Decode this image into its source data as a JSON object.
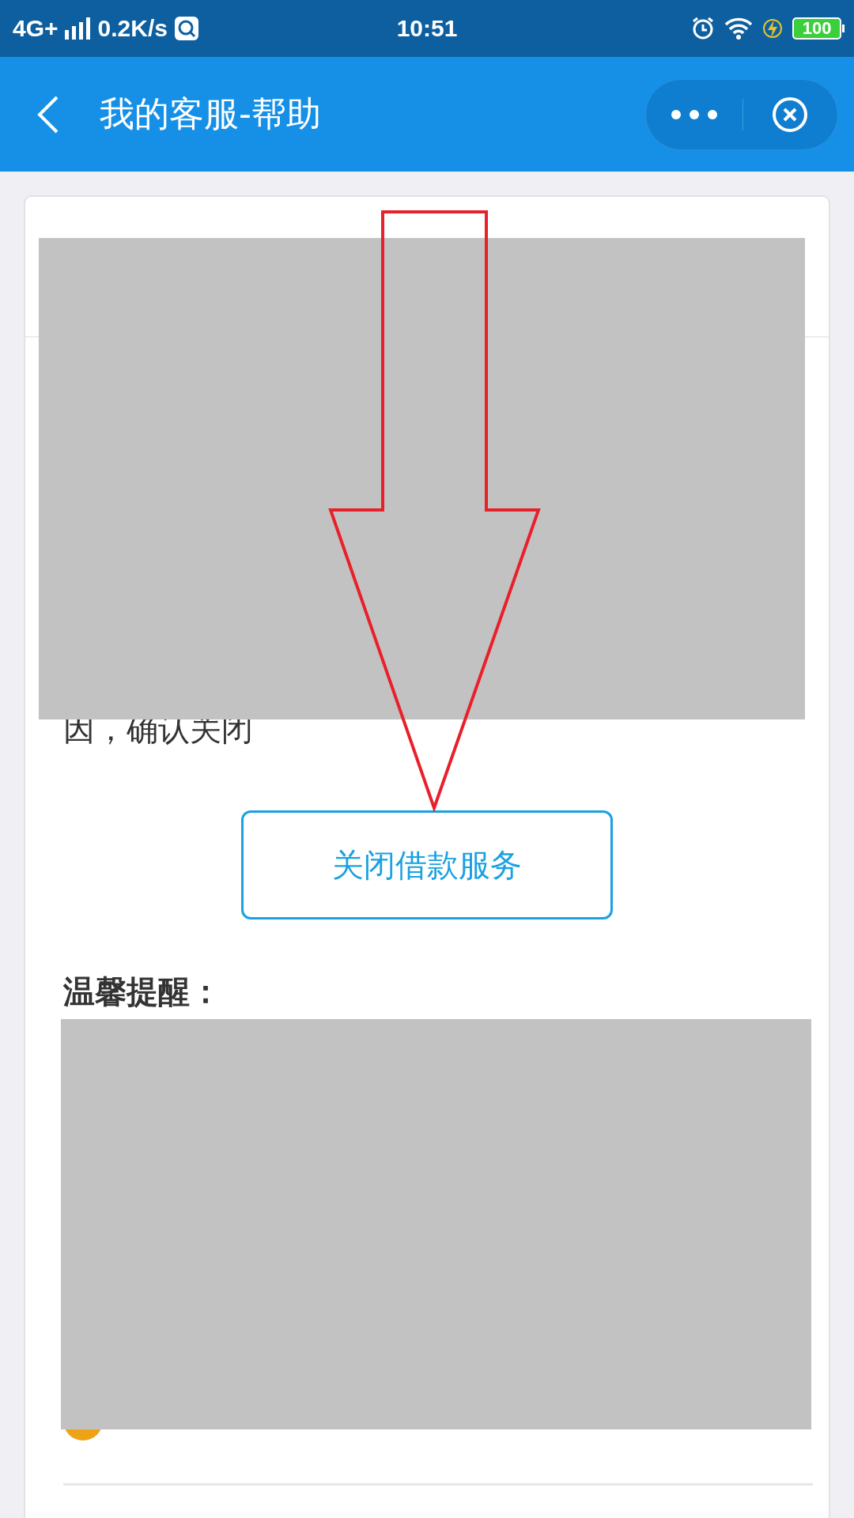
{
  "status_bar": {
    "network": "4G+",
    "speed": "0.2K/s",
    "time": "10:51",
    "battery": "100"
  },
  "nav_bar": {
    "title": "我的客服-帮助"
  },
  "card": {
    "confirm_text": "因，确认关闭",
    "button": "关闭借款服务",
    "reminder_title": "温馨提醒："
  },
  "annotation": {
    "kind": "arrow"
  }
}
